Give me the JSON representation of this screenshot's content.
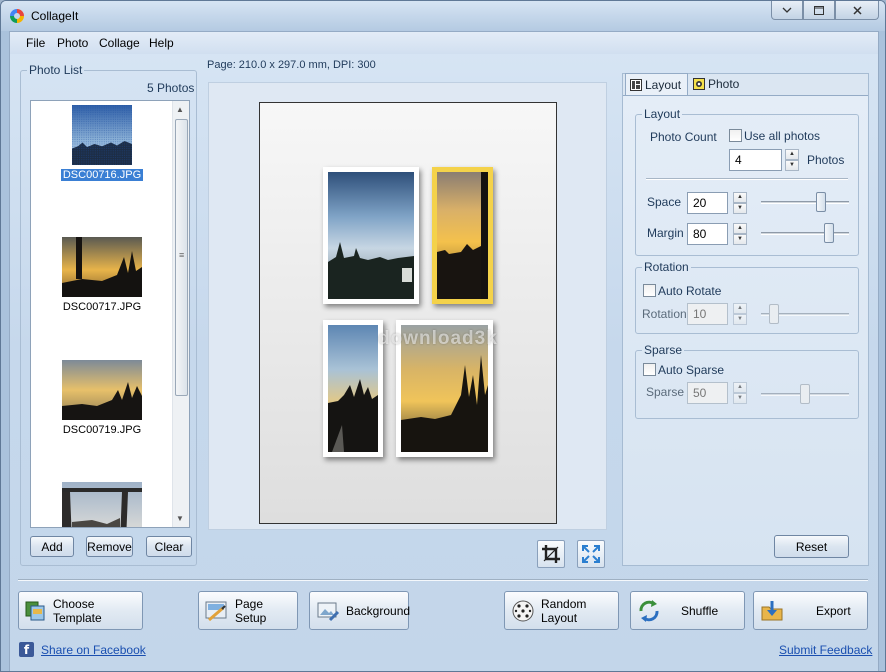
{
  "window": {
    "title": "CollageIt"
  },
  "menu": [
    "File",
    "Photo",
    "Collage",
    "Help"
  ],
  "photo_list": {
    "title": "Photo List",
    "count_text": "5 Photos",
    "items": [
      {
        "name": "DSC00716.JPG",
        "selected": true
      },
      {
        "name": "DSC00717.JPG",
        "selected": false
      },
      {
        "name": "DSC00719.JPG",
        "selected": false
      },
      {
        "name": "",
        "selected": false
      }
    ],
    "buttons": {
      "add": "Add",
      "remove": "Remove",
      "clear": "Clear"
    }
  },
  "page_info": "Page: 210.0 x 297.0 mm, DPI: 300",
  "watermark": "download3k",
  "tabs": {
    "layout": "Layout",
    "photo": "Photo"
  },
  "layout_panel": {
    "layout_group": {
      "title": "Layout",
      "photo_count_label": "Photo Count",
      "use_all_label": "Use all photos",
      "use_all_checked": false,
      "count_value": "4",
      "photos_label": "Photos",
      "space_label": "Space",
      "space_value": "20",
      "margin_label": "Margin",
      "margin_value": "80"
    },
    "rotation_group": {
      "title": "Rotation",
      "auto_rotate_label": "Auto Rotate",
      "auto_rotate_checked": false,
      "rotation_label": "Rotation",
      "rotation_value": "10"
    },
    "sparse_group": {
      "title": "Sparse",
      "auto_sparse_label": "Auto Sparse",
      "auto_sparse_checked": false,
      "sparse_label": "Sparse",
      "sparse_value": "50"
    },
    "reset_label": "Reset"
  },
  "bottom": {
    "choose_template": "Choose Template",
    "page_setup": "Page Setup",
    "background": "Background",
    "random_layout": "Random Layout",
    "shuffle": "Shuffle",
    "export": "Export",
    "share_facebook": "Share on Facebook",
    "submit_feedback": "Submit Feedback"
  },
  "colors": {
    "accent": "#3a7fd4",
    "selected_frame": "#f4d24a",
    "link": "#1a4fb0"
  }
}
